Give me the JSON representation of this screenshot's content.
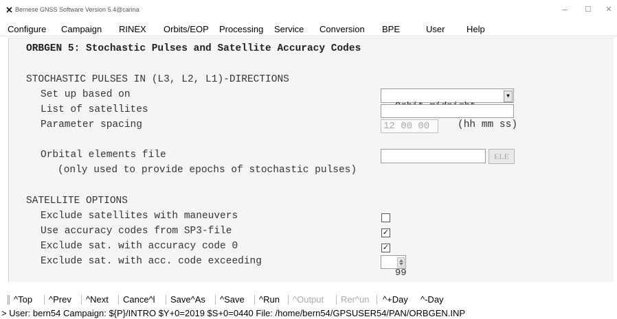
{
  "window": {
    "title": "Bernese GNSS Software Version 5.4@carina",
    "icon": "x-app-icon",
    "controls": {
      "minimize": "–",
      "maximize": "☐",
      "close": "✕"
    }
  },
  "menu": {
    "items": [
      "Configure",
      "Campaign",
      "RINEX",
      "Orbits/EOP",
      "Processing",
      "Service",
      "Conversion",
      "BPE",
      "User",
      "Help"
    ]
  },
  "panel": {
    "title": "ORBGEN 5: Stochastic Pulses and Satellite Accuracy Codes",
    "pulses": {
      "header": "STOCHASTIC PULSES IN (L3, L2, L1)-DIRECTIONS",
      "setup_label": "Set up based on",
      "setup_value": "Orbit_midnight",
      "satlist_label": "List of satellites",
      "satlist_value": "",
      "spacing_label": "Parameter spacing",
      "spacing_value": "12 00 00",
      "spacing_unit": "(hh mm ss)",
      "elefile_label": "Orbital elements file",
      "elefile_value": "",
      "elefile_button": "ELE",
      "elefile_note": "(only used to provide epochs of stochastic pulses)"
    },
    "satellite": {
      "header": "SATELLITE OPTIONS",
      "exclude_maneuvers_label": "Exclude satellites with maneuvers",
      "exclude_maneuvers_checked": false,
      "use_acc_codes_label": "Use accuracy codes from SP3-file",
      "use_acc_codes_checked": true,
      "exclude_code0_label": "Exclude sat. with accuracy code 0",
      "exclude_code0_checked": true,
      "exclude_exceeding_label": "Exclude sat. with acc. code exceeding",
      "exclude_exceeding_value": "99"
    }
  },
  "buttonbar": {
    "top": "^Top",
    "prev": "^Prev",
    "next": "^Next",
    "cancel": "Cance^l",
    "saveas": "Save^As",
    "save": "^Save",
    "run": "^Run",
    "output": "^Output",
    "rerun": "Rer^un",
    "plusday": "^+Day",
    "minusday": "^-Day"
  },
  "status": {
    "text": "> User: bern54  Campaign: ${P}/INTRO  $Y+0=2019  $S+0=0440  File: /home/bern54/GPSUSER54/PAN/ORBGEN.INP"
  }
}
